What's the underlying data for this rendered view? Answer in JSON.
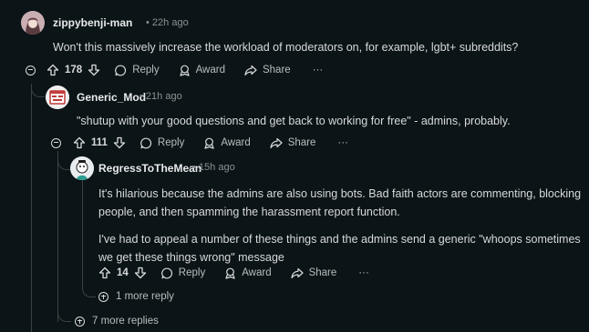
{
  "comments": [
    {
      "user": "zippybenji-man",
      "time": "22h ago",
      "body": [
        "Won't this massively increase the workload of moderators on, for example, lgbt+ subreddits?"
      ],
      "votes": "178",
      "reply_label": "Reply",
      "award_label": "Award",
      "share_label": "Share",
      "more_label": "···"
    },
    {
      "user": "Generic_Mod",
      "time": "21h ago",
      "body": [
        "\"shutup with your good questions and get back to working for free\" - admins, probably."
      ],
      "votes": "111",
      "reply_label": "Reply",
      "award_label": "Award",
      "share_label": "Share",
      "more_label": "···"
    },
    {
      "user": "RegressToTheMean",
      "time": "15h ago",
      "body": [
        "It's hilarious because the admins are also using bots. Bad faith actors are commenting, blocking people, and then spamming the harassment report function.",
        "I've had to appeal a number of these things and the admins send a generic \"whoops sometimes we get these things wrong\" message"
      ],
      "votes": "14",
      "reply_label": "Reply",
      "award_label": "Award",
      "share_label": "Share",
      "more_label": "···"
    }
  ],
  "separator": "•",
  "more_replies_nested": "1 more reply",
  "more_replies_top": "7 more replies",
  "colors": {
    "background": "#0b1416",
    "thread_line": "#3a4244",
    "text": "#d7dadc",
    "muted": "#8a9294"
  }
}
